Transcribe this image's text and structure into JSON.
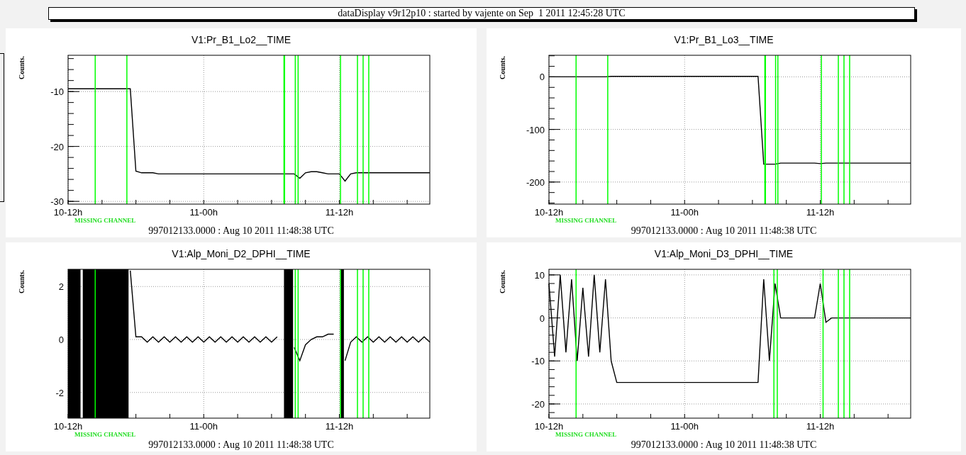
{
  "header": {
    "title": "dataDisplay v9r12p10 : started by vajente on Sep  1 2011 12:45:28 UTC"
  },
  "panels": [
    {
      "status": "MISSING CHANNEL",
      "footer": "997012133.0000 : Aug 10 2011 11:48:38 UTC",
      "chart_data": {
        "type": "line",
        "title": "V1:Pr_B1_Lo2__TIME",
        "ylabel": "Counts.",
        "categories": [
          "10-12h",
          null,
          null,
          null,
          null,
          null,
          null,
          null,
          null,
          null,
          null,
          null,
          null,
          null,
          null,
          null,
          null,
          null,
          null,
          null,
          null,
          null,
          null,
          null,
          "11-00h",
          null,
          null,
          null,
          null,
          null,
          null,
          null,
          null,
          null,
          null,
          null,
          null,
          null,
          null,
          null,
          null,
          null,
          null,
          null,
          null,
          null,
          null,
          null,
          "11-12h",
          null,
          null,
          null,
          null,
          null,
          null,
          null,
          null,
          null,
          null,
          null,
          null,
          null,
          null,
          null,
          null
        ],
        "series": [
          {
            "color": "#000000",
            "values": [
              -9.5,
              -9.5,
              -9.5,
              -9.5,
              -9.5,
              -9.5,
              -9.5,
              -9.5,
              -9.5,
              -9.5,
              -9.5,
              -9.5,
              -24.5,
              -24.8,
              -24.8,
              -24.8,
              -25,
              -25,
              -25,
              -25,
              -25,
              -25,
              -25,
              -25,
              -25,
              -25,
              -25,
              -25,
              -25,
              -25,
              -25,
              -25,
              -25,
              -25,
              -25,
              -25,
              -25,
              -25,
              -25,
              -25,
              -25,
              -25.8,
              -24.8,
              -24.6,
              -24.6,
              -24.8,
              -25,
              -25,
              -25,
              -26.3,
              -25,
              -24.8,
              -24.8,
              -24.8,
              -24.8,
              -24.8,
              -24.8,
              -24.8,
              -24.8,
              -24.8,
              -24.8,
              -24.8,
              -24.8,
              -24.8,
              -24.8
            ]
          }
        ],
        "ylim": [
          -30.5,
          -3.4
        ],
        "yticks": [
          -30,
          -20,
          -10
        ],
        "grid": true
      }
    },
    {
      "status": "MISSING CHANNEL",
      "footer": "997012133.0000 : Aug 10 2011 11:48:38 UTC",
      "chart_data": {
        "type": "line",
        "title": "V1:Pr_B1_Lo3__TIME",
        "ylabel": "Counts.",
        "categories": [
          "10-12h",
          null,
          null,
          null,
          null,
          null,
          null,
          null,
          null,
          null,
          null,
          null,
          null,
          null,
          null,
          null,
          null,
          null,
          null,
          null,
          null,
          null,
          null,
          null,
          "11-00h",
          null,
          null,
          null,
          null,
          null,
          null,
          null,
          null,
          null,
          null,
          null,
          null,
          null,
          null,
          null,
          null,
          null,
          null,
          null,
          null,
          null,
          null,
          null,
          "11-12h",
          null,
          null,
          null,
          null,
          null,
          null,
          null,
          null,
          null,
          null,
          null,
          null,
          null,
          null,
          null,
          null
        ],
        "series": [
          {
            "color": "#000000",
            "values": [
              0,
              0,
              0,
              0,
              0,
              0,
              0,
              0,
              0,
              0,
              0,
              1,
              1,
              1,
              1,
              1,
              1,
              1,
              1,
              1,
              1,
              1,
              1,
              1,
              1,
              1,
              1,
              1,
              1,
              1,
              1,
              1,
              1,
              1,
              1,
              1,
              1,
              1,
              -166,
              -166,
              -166,
              -164,
              -164,
              -164,
              -164,
              -164,
              -164,
              -164,
              -165,
              -164,
              -164,
              -164,
              -164,
              -164,
              -164,
              -164,
              -164,
              -164,
              -164,
              -164,
              -164,
              -164,
              -164,
              -164,
              -164
            ]
          }
        ],
        "ylim": [
          -242,
          41
        ],
        "yticks": [
          -200,
          -100,
          0
        ],
        "grid": true
      }
    },
    {
      "status": "MISSING CHANNEL",
      "footer": "997012133.0000 : Aug 10 2011 11:48:38 UTC",
      "chart_data": {
        "type": "line",
        "title": "V1:Alp_Moni_D2_DPHI__TIME",
        "ylabel": "Counts.",
        "categories": [
          "10-12h",
          null,
          null,
          null,
          null,
          null,
          null,
          null,
          null,
          null,
          null,
          null,
          null,
          null,
          null,
          null,
          null,
          null,
          null,
          null,
          null,
          null,
          null,
          null,
          "11-00h",
          null,
          null,
          null,
          null,
          null,
          null,
          null,
          null,
          null,
          null,
          null,
          null,
          null,
          null,
          null,
          null,
          null,
          null,
          null,
          null,
          null,
          null,
          null,
          "11-12h",
          null,
          null,
          null,
          null,
          null,
          null,
          null,
          null,
          null,
          null,
          null,
          null,
          null,
          null,
          null,
          null
        ],
        "series": [
          {
            "color": "#000000",
            "values": [
              null,
              null,
              null,
              null,
              null,
              null,
              null,
              null,
              null,
              null,
              null,
              2.6,
              0.1,
              0.1,
              -0.1,
              0.1,
              -0.1,
              0.1,
              -0.1,
              0.1,
              -0.1,
              0.1,
              -0.1,
              0.1,
              -0.1,
              0.1,
              -0.1,
              0.1,
              -0.1,
              0.1,
              -0.1,
              0.1,
              -0.1,
              0.1,
              -0.1,
              0.1,
              -0.1,
              0.1,
              null,
              null,
              -0.3,
              -0.8,
              -0.2,
              0,
              0.1,
              0.1,
              0.2,
              0.2,
              null,
              -0.8,
              -0.1,
              0.1,
              -0.1,
              0.1,
              -0.1,
              0.1,
              -0.1,
              0.1,
              -0.1,
              0.1,
              -0.1,
              0.1,
              -0.1,
              0.1,
              -0.1
            ]
          }
        ],
        "ylim": [
          -2.97,
          2.65
        ],
        "yticks": [
          -2,
          0,
          2
        ],
        "grid": true
      }
    },
    {
      "status": "MISSING CHANNEL",
      "footer": "997012133.0000 : Aug 10 2011 11:48:38 UTC",
      "chart_data": {
        "type": "line",
        "title": "V1:Alp_Moni_D3_DPHI__TIME",
        "ylabel": "Counts.",
        "categories": [
          "10-12h",
          null,
          null,
          null,
          null,
          null,
          null,
          null,
          null,
          null,
          null,
          null,
          null,
          null,
          null,
          null,
          null,
          null,
          null,
          null,
          null,
          null,
          null,
          null,
          "11-00h",
          null,
          null,
          null,
          null,
          null,
          null,
          null,
          null,
          null,
          null,
          null,
          null,
          null,
          null,
          null,
          null,
          null,
          null,
          null,
          null,
          null,
          null,
          null,
          "11-12h",
          null,
          null,
          null,
          null,
          null,
          null,
          null,
          null,
          null,
          null,
          null,
          null,
          null,
          null,
          null,
          null
        ],
        "series": [
          {
            "color": "#000000",
            "values": [
              8,
              -9,
              10,
              -8,
              9,
              -10,
              7,
              -9,
              10,
              -8,
              9,
              -10,
              -15,
              -15,
              -15,
              -15,
              -15,
              -15,
              -15,
              -15,
              -15,
              -15,
              -15,
              -15,
              -15,
              -15,
              -15,
              -15,
              -15,
              -15,
              -15,
              -15,
              -15,
              -15,
              -15,
              -15,
              -15,
              -15,
              9,
              -10,
              8,
              0,
              0,
              0,
              0,
              0,
              0,
              0,
              8,
              -1,
              0,
              0,
              0,
              0,
              0,
              0,
              0,
              0,
              0,
              0,
              0,
              0,
              0,
              0,
              0
            ]
          }
        ],
        "ylim": [
          -23.3,
          11.3
        ],
        "yticks": [
          -20,
          -10,
          0,
          10
        ],
        "grid": true
      }
    }
  ]
}
